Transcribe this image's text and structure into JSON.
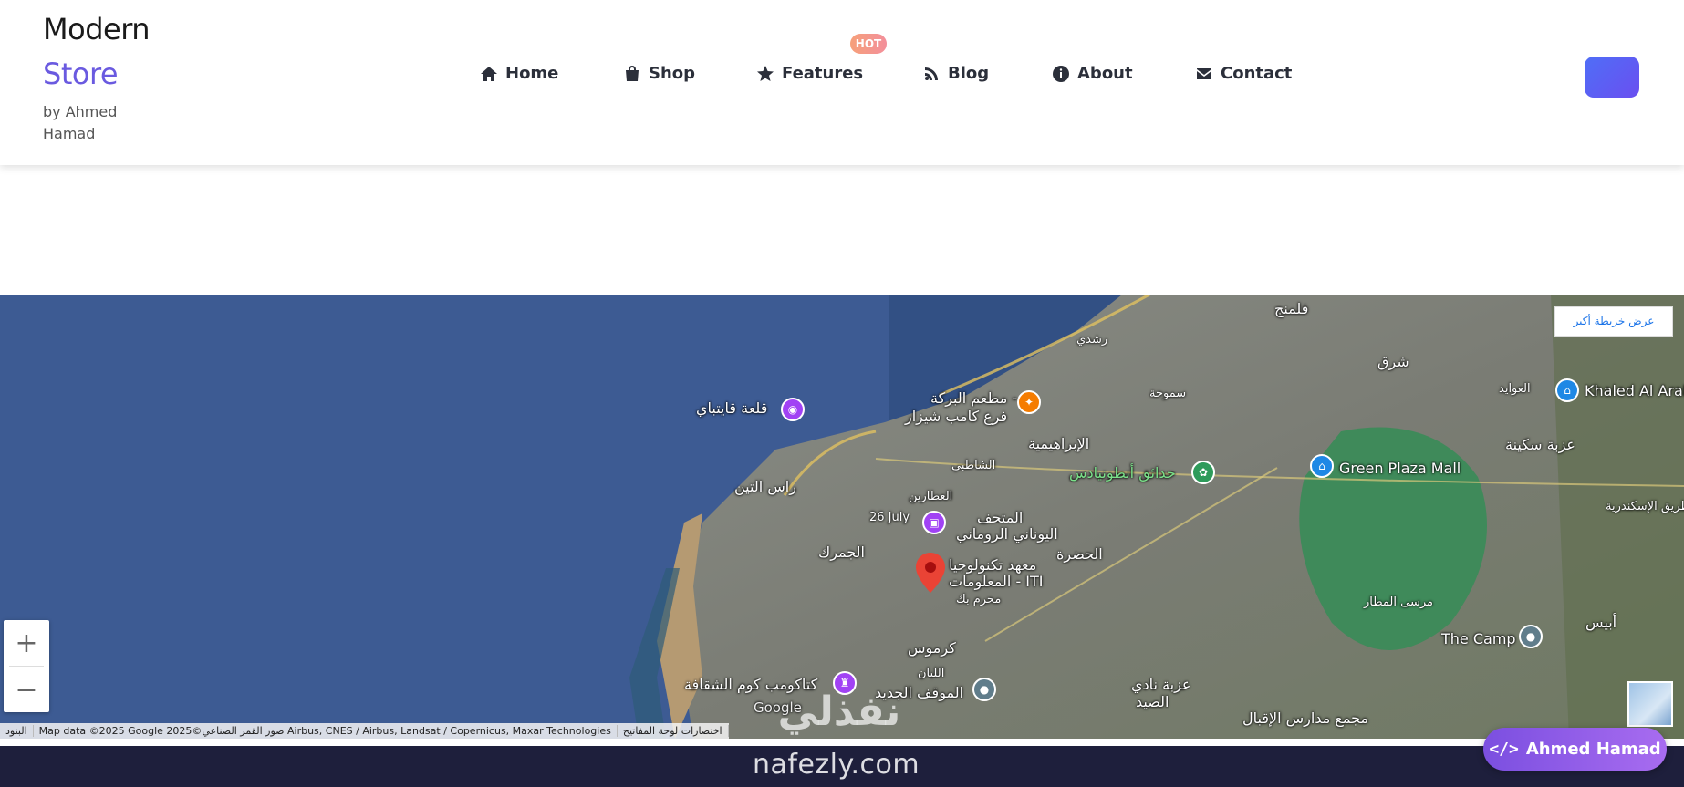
{
  "brand": {
    "line1": "Modern",
    "line2": "Store",
    "byline": "by Ahmed Hamad"
  },
  "nav": {
    "items": [
      {
        "label": "Home",
        "icon": "home-icon"
      },
      {
        "label": "Shop",
        "icon": "shopping-bag-icon"
      },
      {
        "label": "Features",
        "icon": "star-icon"
      },
      {
        "label": "Blog",
        "icon": "blog-icon"
      },
      {
        "label": "About",
        "icon": "info-icon"
      },
      {
        "label": "Contact",
        "icon": "envelope-icon"
      }
    ],
    "hot_badge": "HOT"
  },
  "map": {
    "larger_map_label": "عرض خريطة أكبر",
    "zoom_in": "+",
    "zoom_out": "−",
    "attribution": {
      "terms": "البنود",
      "data": "Map data ©2025 Google 2025©صور القمر الصناعي Airbus, CNES / Airbus, Landsat / Copernicus, Maxar Technologies",
      "shortcuts": "اختصارات لوحة المفاتيح"
    },
    "google_logo": "Google",
    "labels": {
      "falamanj": "فلمنج",
      "rushdy": "رشدي",
      "smouha": "سموحة",
      "shark": "شرق",
      "awayed": "العوايد",
      "khaled": "Khaled Al Arab",
      "sakina": "عزبة سكينة",
      "qaitbay": "قلعة قايتباي",
      "baraka1": "مطعم البركة -",
      "baraka2": "فرع كامب شيزار",
      "ibrahimia": "الإبراهيمية",
      "shatby": "الشاطبي",
      "antoniadis": "حدائق أنطونيادس",
      "green_plaza": "Green Plaza Mall",
      "ras_tin": "راس التين",
      "attarin": "العطارين",
      "museum1": "المتحف",
      "museum2": "اليوناني الروماني",
      "hadra": "الحضرة",
      "gomrok": "الجمرك",
      "iti1": "معهد تكنولوجيا",
      "iti2": "المعلومات - ITI",
      "moharam": "محرم بك",
      "karmouz": "كرموس",
      "labban": "اللبان",
      "mawkef": "الموقف الجديد",
      "catacombs": "كتاكومب كوم الشقافة",
      "the_camp": "The Camp",
      "abis": "أبيس",
      "mariout": "مرسى المطار",
      "nady_said1": "عزبة نادي",
      "nady_said2": "الصيد",
      "mazmaa": "مجمع مدارس الإقبال",
      "road_26july": "26 July",
      "alex_road": "طريق الإسكندرية"
    }
  },
  "footer": {
    "watermark": "nafezly.com",
    "watermark_ar": "نفذلي",
    "author_button": "Ahmed Hamad"
  },
  "colors": {
    "brand_accent": "#6a5ae0",
    "cta": "#5a5ff5",
    "author_pill": "#8e5ae8",
    "footer_bg": "#1e1f3c",
    "sea": "#3c5a92"
  }
}
